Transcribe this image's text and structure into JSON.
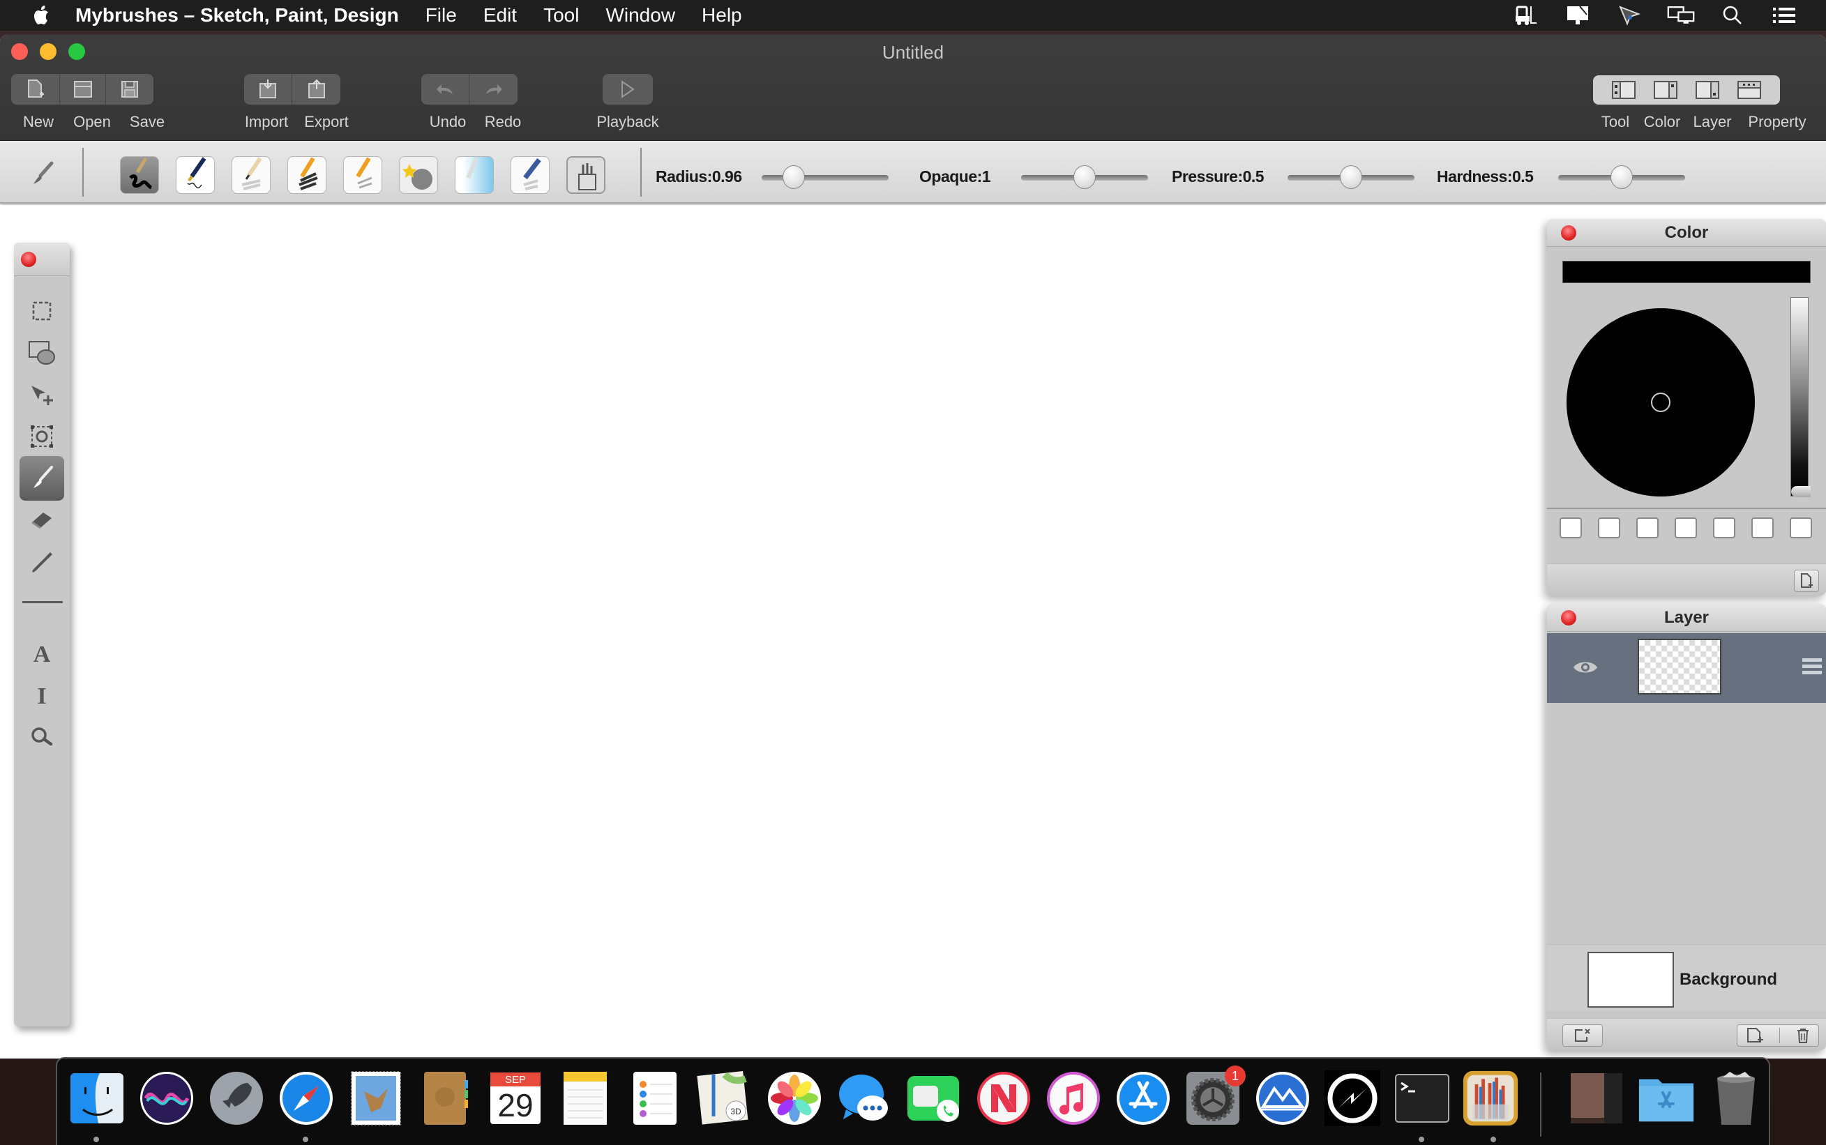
{
  "menubar": {
    "app_name": "Mybrushes – Sketch, Paint, Design",
    "menus": [
      "File",
      "Edit",
      "Tool",
      "Window",
      "Help"
    ],
    "status_icons": [
      "forklift-icon",
      "display-icon",
      "cursor-pro-icon",
      "screens-icon",
      "spotlight-search-icon",
      "control-center-list-icon"
    ]
  },
  "window": {
    "title": "Untitled",
    "toolbar": {
      "new": "New",
      "open": "Open",
      "save": "Save",
      "import": "Import",
      "export": "Export",
      "undo": "Undo",
      "redo": "Redo",
      "playback": "Playback",
      "view_tool": "Tool",
      "view_color": "Color",
      "view_layer": "Layer",
      "view_property": "Property"
    }
  },
  "brushbar": {
    "presets": [
      "ink-brush",
      "fountain-pen",
      "pencil-soft",
      "charcoal-pencil",
      "color-pencil",
      "star-spray",
      "watercolor",
      "airbrush",
      "brush-set"
    ],
    "selected_preset": "ink-brush",
    "sliders": [
      {
        "label": "Radius:0.96",
        "value": 0.96,
        "position": 0.25
      },
      {
        "label": "Opaque:1",
        "value": 1,
        "position": 0.5
      },
      {
        "label": "Pressure:0.5",
        "value": 0.5,
        "position": 0.5
      },
      {
        "label": "Hardness:0.5",
        "value": 0.5,
        "position": 0.5
      }
    ]
  },
  "tools": [
    {
      "name": "rect-select",
      "icon": "marquee-select-icon"
    },
    {
      "name": "shape",
      "icon": "shape-icon"
    },
    {
      "name": "move",
      "icon": "move-arrow-icon"
    },
    {
      "name": "transform",
      "icon": "transform-rotate-icon"
    },
    {
      "name": "brush",
      "icon": "paintbrush-icon",
      "active": true
    },
    {
      "name": "eraser",
      "icon": "eraser-icon"
    },
    {
      "name": "eyedropper",
      "icon": "eyedropper-icon"
    },
    {
      "name": "line",
      "icon": "line-icon"
    },
    {
      "name": "text",
      "icon": "text-A-icon"
    },
    {
      "name": "text-cursor",
      "icon": "text-cursor-icon"
    },
    {
      "name": "zoom",
      "icon": "magnifier-icon"
    }
  ],
  "color_panel": {
    "title": "Color",
    "current_color": "#000000",
    "brightness": 0.0,
    "swatches": [
      "#ffffff",
      "#ffffff",
      "#ffffff",
      "#ffffff",
      "#ffffff",
      "#ffffff",
      "#ffffff"
    ]
  },
  "layer_panel": {
    "title": "Layer",
    "layers": [
      {
        "name": "",
        "visible": true,
        "transparent": true,
        "selected": true
      }
    ],
    "background_label": "Background"
  },
  "dock": {
    "apps": [
      "Finder",
      "Siri",
      "Launchpad",
      "Safari",
      "Mail",
      "Contacts",
      "Calendar",
      "Notes",
      "Reminders",
      "Maps",
      "Photos",
      "Messages",
      "FaceTime",
      "News",
      "iTunes",
      "App Store",
      "System Preferences",
      "Mountain Duck",
      "Cursor",
      "Terminal",
      "Mybrushes",
      "Downloads Stack",
      "Applications",
      "Trash"
    ],
    "calendar_month": "SEP",
    "calendar_day": "29",
    "system_prefs_badge": "1",
    "running": [
      "Finder",
      "Safari",
      "Terminal",
      "Mybrushes"
    ]
  }
}
